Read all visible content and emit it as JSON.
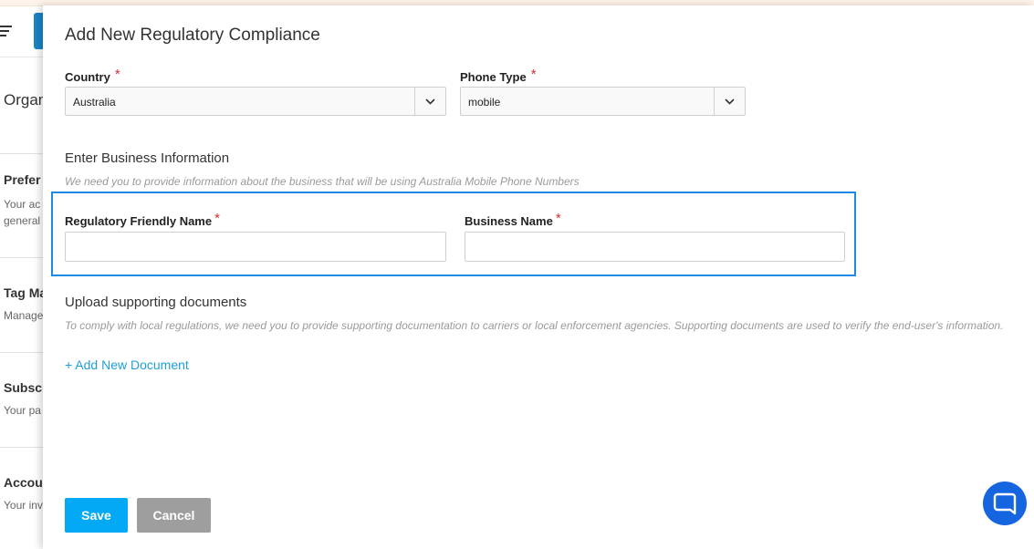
{
  "background": {
    "heading": "Organ",
    "rows": [
      {
        "title": "Prefer",
        "sub1": "Your ac",
        "sub2": "general"
      },
      {
        "title": "Tag Ma",
        "sub1": "Manage",
        "sub2": ""
      },
      {
        "title": "Subscr",
        "sub1": "Your pa",
        "sub2": ""
      },
      {
        "title": "Accou",
        "sub1": "Your inv",
        "sub2": ""
      }
    ]
  },
  "drawer": {
    "title": "Add New Regulatory Compliance",
    "country": {
      "label": "Country",
      "required": "*",
      "value": "Australia"
    },
    "phone_type": {
      "label": "Phone Type",
      "required": "*",
      "value": "mobile"
    },
    "business_section": {
      "title": "Enter Business Information",
      "hint": "We need you to provide information about the business that will be using Australia Mobile Phone Numbers"
    },
    "regulatory_friendly_name": {
      "label": "Regulatory Friendly Name",
      "required": "*",
      "value": "",
      "placeholder": ""
    },
    "business_name": {
      "label": "Business Name",
      "required": "*",
      "value": "",
      "placeholder": ""
    },
    "documents_section": {
      "title": "Upload supporting documents",
      "hint": "To comply with local regulations, we need you to provide supporting documentation to carriers or local enforcement agencies. Supporting documents are used to verify the end-user's information.",
      "add_link": "+ Add New Document"
    },
    "save_label": "Save",
    "cancel_label": "Cancel"
  },
  "icons": {
    "chevron": "chevron-down-icon",
    "chat": "chat-bubble-icon",
    "menu": "hamburger-menu-icon"
  },
  "colors": {
    "accent": "#03a9f4",
    "focus": "#1e88e5",
    "chat": "#1565e0",
    "required": "#d32f2f"
  }
}
